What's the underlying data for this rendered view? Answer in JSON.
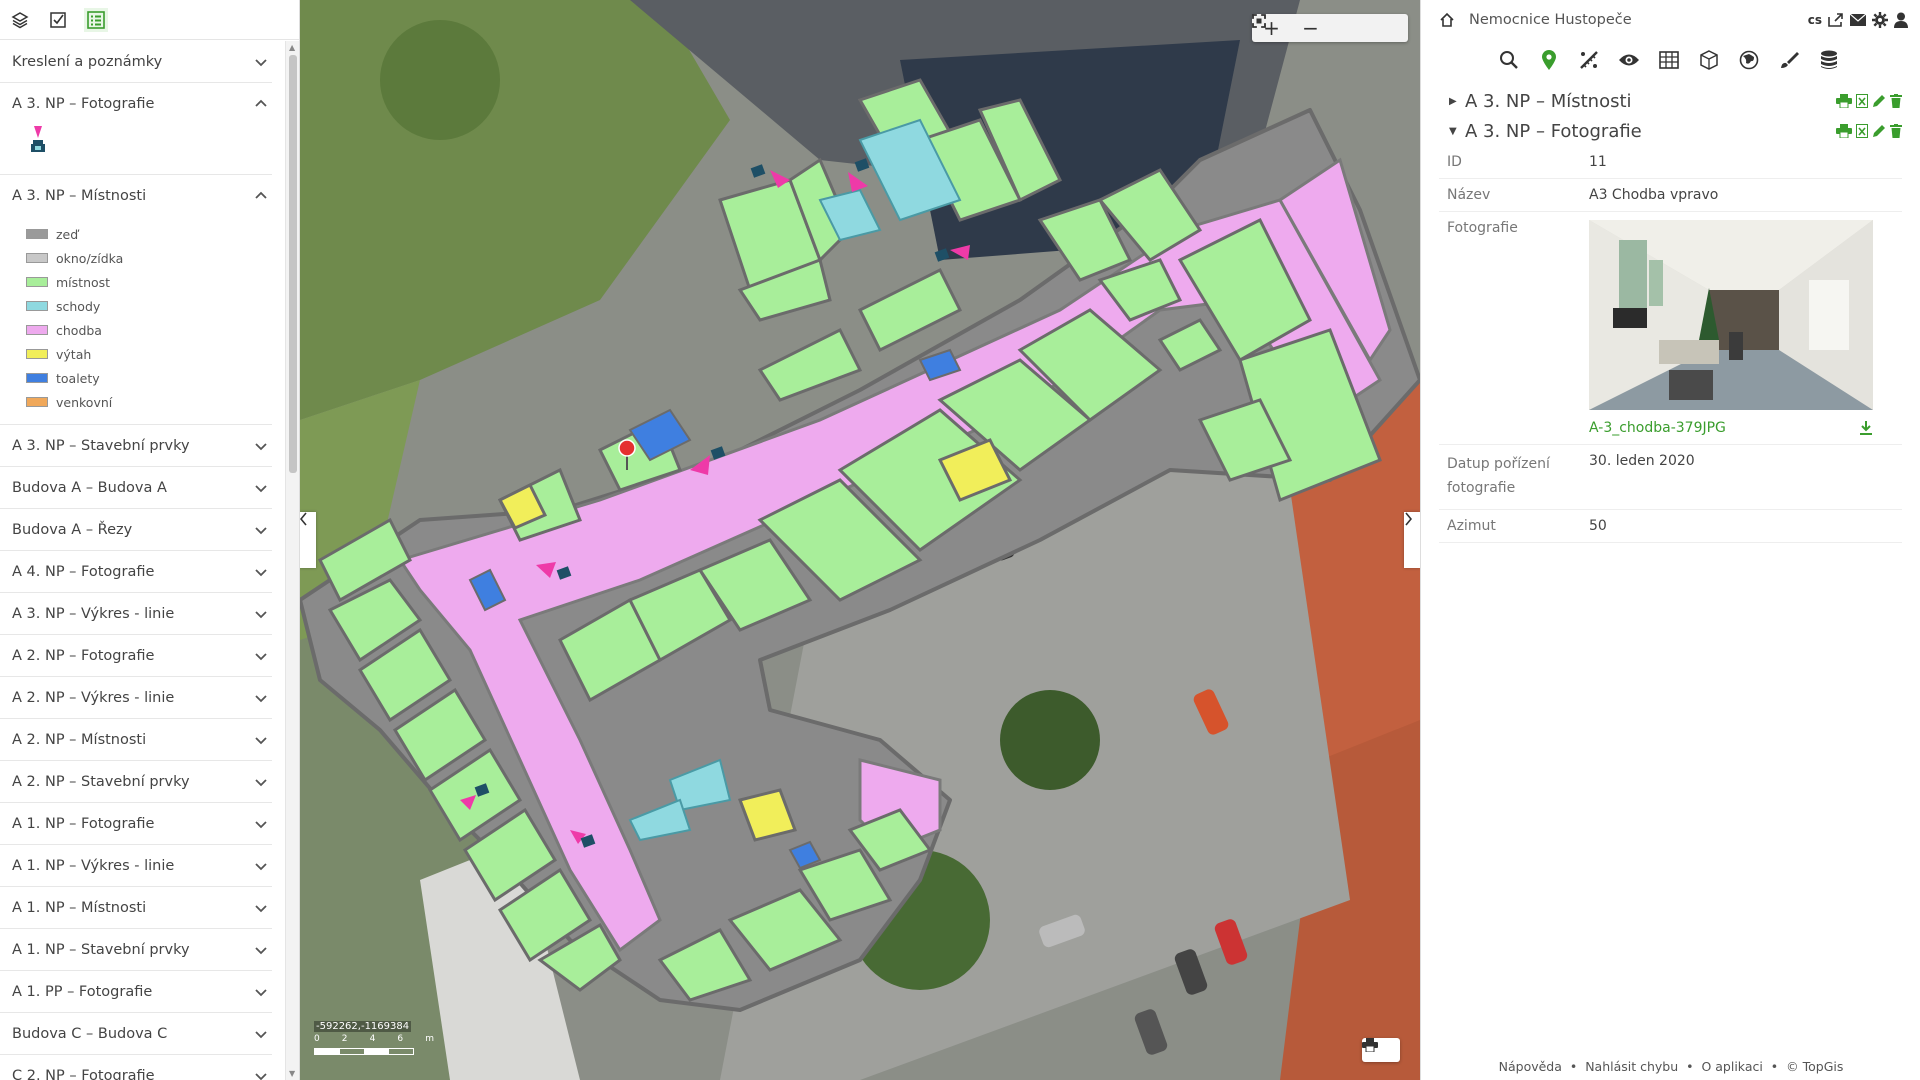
{
  "left": {
    "sections": [
      {
        "label": "Kreslení a poznámky",
        "expanded": false
      },
      {
        "label": "A 3. NP – Fotografie",
        "expanded": true,
        "type": "photo"
      },
      {
        "label": "A 3. NP – Místnosti",
        "expanded": true,
        "type": "legend"
      },
      {
        "label": "A 3. NP – Stavební prvky",
        "expanded": false
      },
      {
        "label": "Budova A – Budova A",
        "expanded": false
      },
      {
        "label": "Budova A – Řezy",
        "expanded": false
      },
      {
        "label": "A 4. NP – Fotografie",
        "expanded": false
      },
      {
        "label": "A 3. NP – Výkres - linie",
        "expanded": false
      },
      {
        "label": "A 2. NP – Fotografie",
        "expanded": false
      },
      {
        "label": "A 2. NP – Výkres - linie",
        "expanded": false
      },
      {
        "label": "A 2. NP – Místnosti",
        "expanded": false
      },
      {
        "label": "A 2. NP – Stavební prvky",
        "expanded": false
      },
      {
        "label": "A 1. NP – Fotografie",
        "expanded": false
      },
      {
        "label": "A 1. NP – Výkres - linie",
        "expanded": false
      },
      {
        "label": "A 1. NP – Místnosti",
        "expanded": false
      },
      {
        "label": "A 1. NP – Stavební prvky",
        "expanded": false
      },
      {
        "label": "A 1. PP – Fotografie",
        "expanded": false
      },
      {
        "label": "Budova C – Budova C",
        "expanded": false
      },
      {
        "label": "C 2. NP – Fotografie",
        "expanded": false
      }
    ],
    "legend": [
      {
        "label": "zeď",
        "color": "#9a9a9a"
      },
      {
        "label": "okno/zídka",
        "color": "#c8c8c8"
      },
      {
        "label": "místnost",
        "color": "#a8ee9a"
      },
      {
        "label": "schody",
        "color": "#8fd9e0"
      },
      {
        "label": "chodba",
        "color": "#eeaaee"
      },
      {
        "label": "výtah",
        "color": "#f1ee5a"
      },
      {
        "label": "toalety",
        "color": "#3f7fe0"
      },
      {
        "label": "venkovní",
        "color": "#f0a85a"
      }
    ]
  },
  "map": {
    "coords": "-592262,-1169384",
    "scale_labels": [
      "0",
      "2",
      "4",
      "6",
      "m"
    ],
    "colors": {
      "room": "#a8ee9a",
      "corridor": "#eeaaee",
      "wall": "#8a8a8a",
      "stairs": "#8fd9e0",
      "elevator": "#f1ee5a",
      "toilet": "#3f7fe0",
      "marker": "#e53030"
    }
  },
  "right": {
    "title": "Nemocnice Hustopeče",
    "lang": "cs",
    "results": [
      {
        "title": "A 3. NP – Místnosti",
        "expanded": false
      },
      {
        "title": "A 3. NP – Fotografie",
        "expanded": true
      }
    ],
    "attributes": {
      "id_label": "ID",
      "id_value": "11",
      "name_label": "Název",
      "name_value": "A3 Chodba vpravo",
      "photo_label": "Fotografie",
      "photo_file": "A-3_chodba-379JPG",
      "date_label": "Datup pořízení fotografie",
      "date_value": "30. leden 2020",
      "azimuth_label": "Azimut",
      "azimuth_value": "50"
    },
    "footer": [
      "Nápověda",
      "Nahlásit chybu",
      "O aplikaci",
      "© TopGis"
    ],
    "accent": "#3a9d2d"
  }
}
